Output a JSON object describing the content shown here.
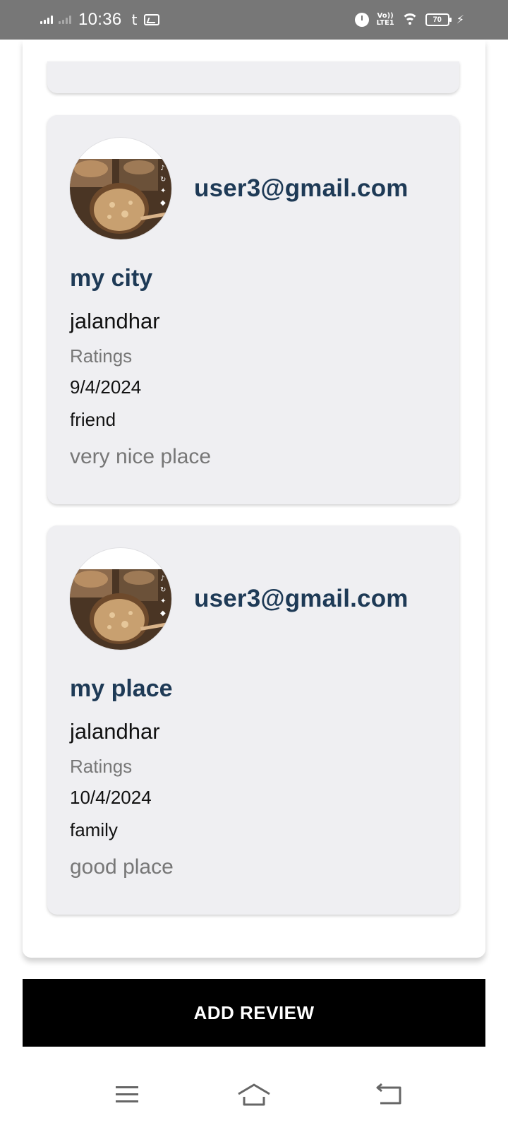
{
  "status_bar": {
    "time": "10:36",
    "extra_glyph": "t",
    "network": "Vo)) LTE1",
    "battery": "70"
  },
  "reviews": [
    {
      "email": "user3@gmail.com",
      "title": "my city",
      "city": "jalandhar",
      "ratings_label": "Ratings",
      "date": "9/4/2024",
      "relation": "friend",
      "comment": "very nice place"
    },
    {
      "email": "user3@gmail.com",
      "title": "my place",
      "city": "jalandhar",
      "ratings_label": "Ratings",
      "date": "10/4/2024",
      "relation": "family",
      "comment": "good place"
    }
  ],
  "add_button": {
    "label": "ADD REVIEW"
  },
  "nav_bar": {
    "icons": [
      "menu-icon",
      "home-icon",
      "back-icon"
    ]
  }
}
